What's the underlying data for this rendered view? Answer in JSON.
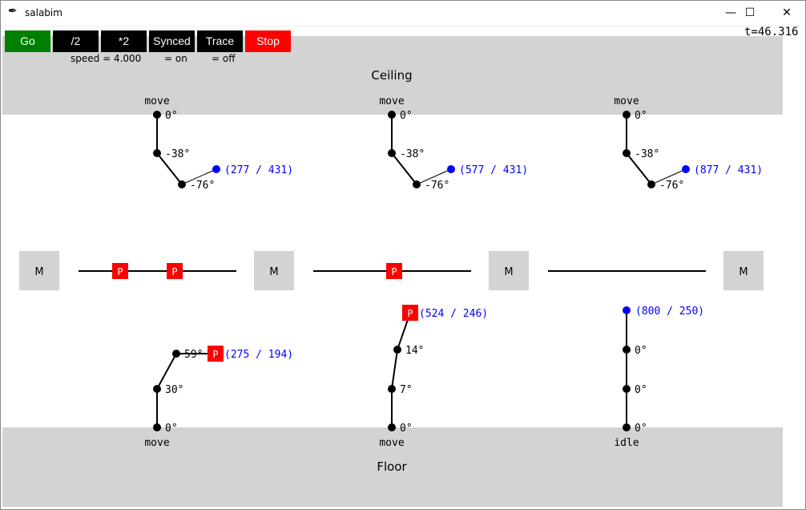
{
  "window": {
    "title": "salabim",
    "minimize": "—",
    "maximize": "☐",
    "close": "✕"
  },
  "toolbar": {
    "buttons": [
      {
        "label": "Go",
        "color": "#008000"
      },
      {
        "label": "/2",
        "color": "#000000"
      },
      {
        "label": "*2",
        "color": "#000000"
      },
      {
        "label": "Synced",
        "color": "#000000"
      },
      {
        "label": "Trace",
        "color": "#000000"
      },
      {
        "label": "Stop",
        "color": "#ff0000"
      }
    ],
    "speed": "speed = 4.000",
    "synced": "= on",
    "trace": "= off"
  },
  "time": "t=46.316",
  "ceiling": {
    "label": "Ceiling"
  },
  "floor": {
    "label": "Floor"
  },
  "colors": {
    "zone": "#d3d3d3",
    "product": "#ff0000",
    "target": "#0000ff"
  },
  "top_robots": [
    {
      "status": "move",
      "angles": [
        "0°",
        "-38°",
        "-76°"
      ],
      "target": "(277 / 431)"
    },
    {
      "status": "move",
      "angles": [
        "0°",
        "-38°",
        "-76°"
      ],
      "target": "(577 / 431)"
    },
    {
      "status": "move",
      "angles": [
        "0°",
        "-38°",
        "-76°"
      ],
      "target": "(877 / 431)"
    }
  ],
  "bottom_robots": [
    {
      "status": "move",
      "angles": [
        "0°",
        "30°",
        "59°"
      ],
      "target": "(275 / 194)",
      "holding": "P"
    },
    {
      "status": "move",
      "angles": [
        "0°",
        "7°",
        "14°"
      ],
      "target": "(524 / 246)",
      "holding": "P"
    },
    {
      "status": "idle",
      "angles": [
        "0°",
        "0°",
        "0°"
      ],
      "target": "(800 / 250)",
      "holding": ""
    }
  ],
  "machines": [
    "M",
    "M",
    "M",
    "M"
  ],
  "conveyor_products": [
    [
      "P",
      "P"
    ],
    [
      "P"
    ],
    []
  ]
}
